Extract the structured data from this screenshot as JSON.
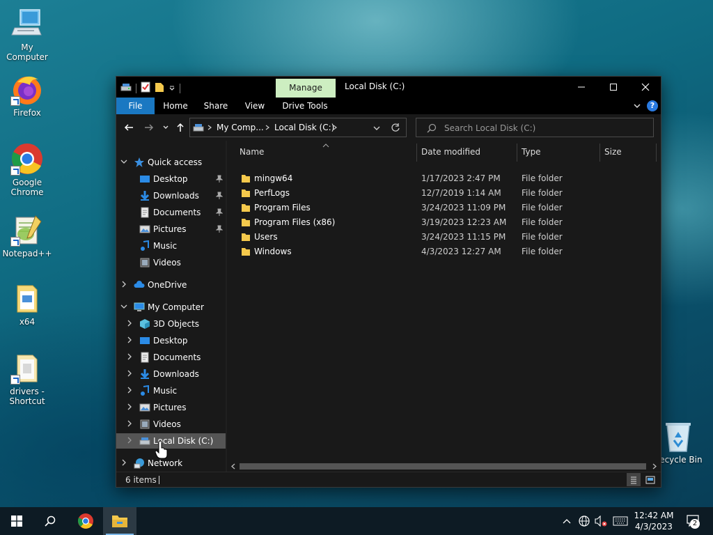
{
  "desktop": {
    "icons": [
      {
        "label": "My Computer",
        "icon": "my-computer-icon"
      },
      {
        "label": "Firefox",
        "icon": "firefox-icon"
      },
      {
        "label": "Google Chrome",
        "icon": "chrome-icon"
      },
      {
        "label": "Notepad++",
        "icon": "notepadpp-icon"
      },
      {
        "label": "x64",
        "icon": "folder-icon"
      },
      {
        "label": "drivers - Shortcut",
        "icon": "folder-shortcut-icon"
      },
      {
        "label": "Recycle Bin",
        "icon": "recycle-bin-icon"
      }
    ]
  },
  "explorer": {
    "title": "Local Disk (C:)",
    "manage_tab": "Manage",
    "ribbon_tabs": {
      "file": "File",
      "home": "Home",
      "share": "Share",
      "view": "View",
      "drive_tools": "Drive Tools"
    },
    "address": {
      "crumb1": "My Comp...",
      "crumb2": "Local Disk (C:)"
    },
    "search": {
      "placeholder": "Search Local Disk (C:)"
    },
    "help": "?",
    "nav": {
      "quick_access": "Quick access",
      "qa_desktop": "Desktop",
      "qa_downloads": "Downloads",
      "qa_documents": "Documents",
      "qa_pictures": "Pictures",
      "qa_music": "Music",
      "qa_videos": "Videos",
      "onedrive": "OneDrive",
      "my_computer": "My Computer",
      "mc_3d": "3D Objects",
      "mc_desktop": "Desktop",
      "mc_documents": "Documents",
      "mc_downloads": "Downloads",
      "mc_music": "Music",
      "mc_pictures": "Pictures",
      "mc_videos": "Videos",
      "mc_local_disk": "Local Disk (C:)",
      "network": "Network"
    },
    "columns": {
      "name": "Name",
      "date": "Date modified",
      "type": "Type",
      "size": "Size"
    },
    "files": [
      {
        "name": "mingw64",
        "date": "1/17/2023 2:47 PM",
        "type": "File folder"
      },
      {
        "name": "PerfLogs",
        "date": "12/7/2019 1:14 AM",
        "type": "File folder"
      },
      {
        "name": "Program Files",
        "date": "3/24/2023 11:09 PM",
        "type": "File folder"
      },
      {
        "name": "Program Files (x86)",
        "date": "3/19/2023 12:23 AM",
        "type": "File folder"
      },
      {
        "name": "Users",
        "date": "3/24/2023 11:15 PM",
        "type": "File folder"
      },
      {
        "name": "Windows",
        "date": "4/3/2023 12:27 AM",
        "type": "File folder"
      }
    ],
    "status": "6 items"
  },
  "taskbar": {
    "time": "12:42 AM",
    "date": "4/3/2023",
    "notifications": "2"
  },
  "colors": {
    "manage_tab": "#cdeec1",
    "file_tab": "#1a78c2",
    "folder": "#f5c94c",
    "selected_nav": "#555555",
    "window_bg": "#191919"
  }
}
